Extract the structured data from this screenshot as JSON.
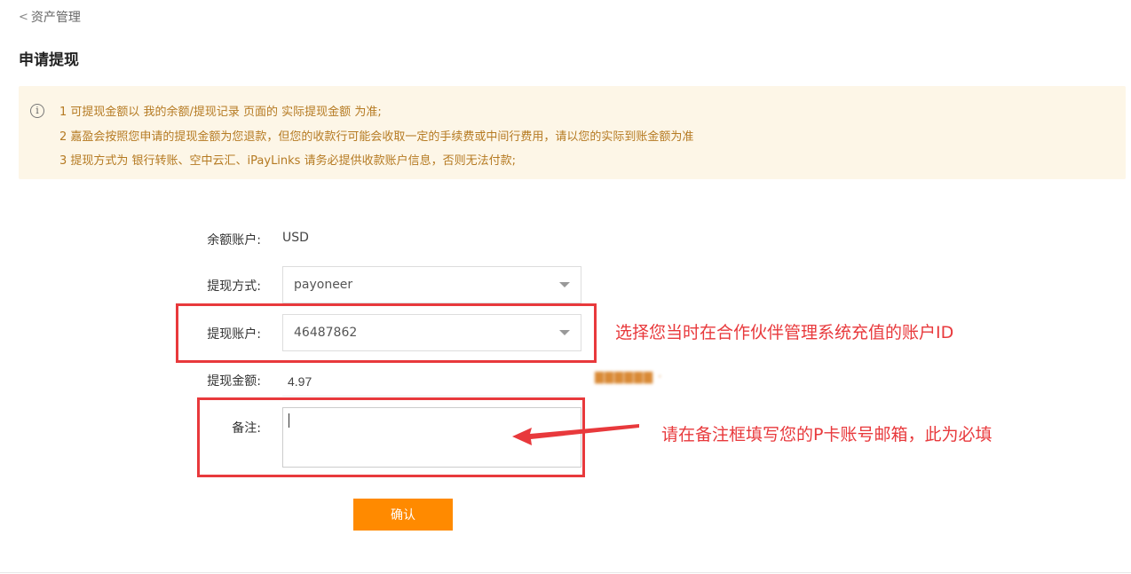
{
  "breadcrumb": {
    "back_label": "资产管理"
  },
  "page_title": "申请提现",
  "notice": {
    "line1": "1  可提现金额以 我的余额/提现记录 页面的 实际提现金额 为准;",
    "line2": "2  嘉盈会按照您申请的提现金额为您退款，但您的收款行可能会收取一定的手续费或中间行费用，请以您的实际到账金额为准",
    "line3": "3  提现方式为 银行转账、空中云汇、iPayLinks 请务必提供收款账户信息，否则无法付款;"
  },
  "form": {
    "balance_account_label": "余额账户:",
    "balance_account_value": "USD",
    "method_label": "提现方式:",
    "method_value": "payoneer",
    "account_label": "提现账户:",
    "account_value": "46487862",
    "amount_label": "提现金额:",
    "amount_value": "4.97",
    "remark_label": "备注:",
    "confirm_label": "确认"
  },
  "annotations": {
    "account_hint": "选择您当时在合作伙伴管理系统充值的账户ID",
    "remark_hint": "请在备注框填写您的P卡账号邮箱，此为必填"
  },
  "colors": {
    "accent": "#ff8a00",
    "annotation_red": "#e8393c",
    "notice_bg": "#fdf6e7",
    "notice_text": "#b57a22"
  }
}
